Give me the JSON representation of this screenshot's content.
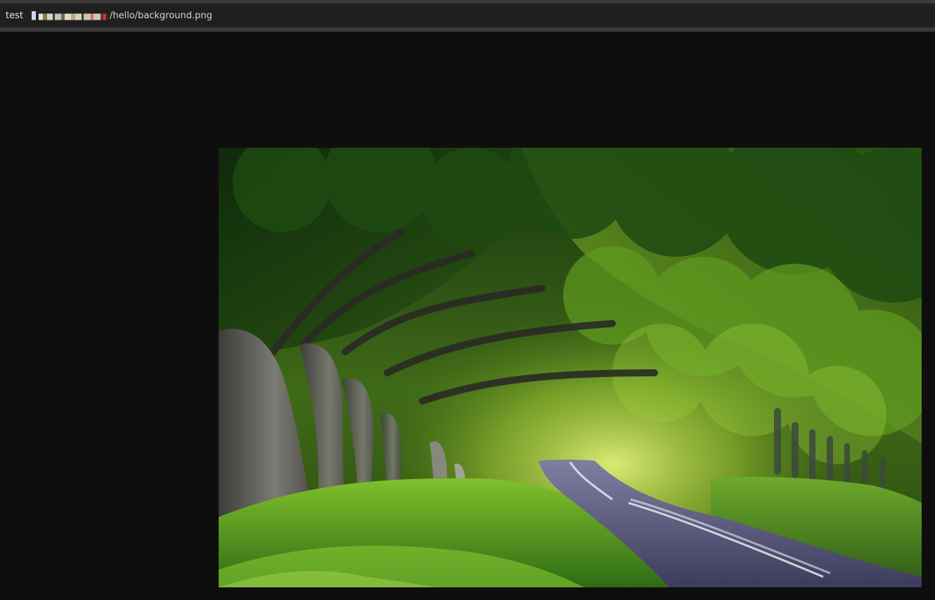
{
  "tab": {
    "name": "test",
    "path_suffix": "/hello/background.png"
  },
  "viewer": {
    "image_alt": "background.png"
  }
}
